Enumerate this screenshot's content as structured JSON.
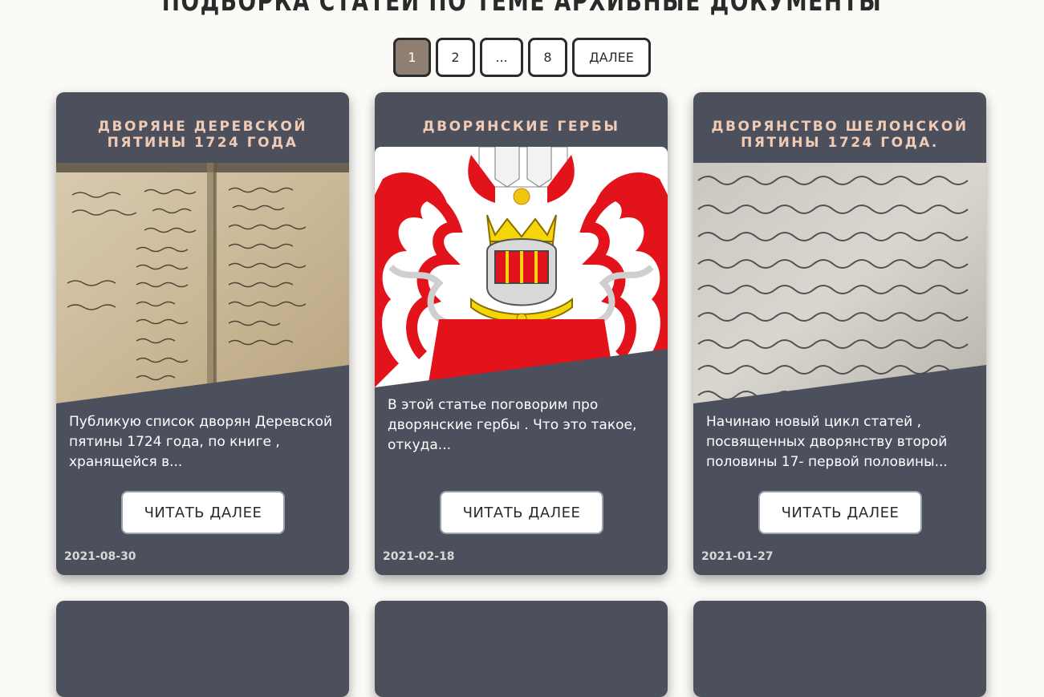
{
  "page": {
    "heading": "ПОДБОРКА СТАТЕЙ ПО ТЕМЕ АРХИВНЫЕ ДОКУМЕНТЫ"
  },
  "pagination": {
    "pages": [
      "1",
      "2",
      "...",
      "8"
    ],
    "current": "1",
    "next_label": "ДАЛЕЕ"
  },
  "articles": [
    {
      "title": "ДВОРЯНЕ ДЕРЕВСКОЙ ПЯТИНЫ 1724 ГОДА",
      "image_icon": "manuscript-photo",
      "description": "Публикую список дворян Деревской пятины 1724 года, по книге , хранящейся в...",
      "button_label": "ЧИТАТЬ ДАЛЕЕ",
      "date": "2021-08-30"
    },
    {
      "title": "ДВОРЯНСКИЕ ГЕРБЫ",
      "image_icon": "coat-of-arms-image",
      "description": "В этой статье поговорим про дворянские гербы . Что это такое, откуда...",
      "button_label": "ЧИТАТЬ ДАЛЕЕ",
      "date": "2021-02-18"
    },
    {
      "title": "ДВОРЯНСТВО ШЕЛОНСКОЙ ПЯТИНЫ 1724 ГОДА.",
      "image_icon": "handwritten-document-photo",
      "description": "Начинаю новый цикл статей , посвященных дворянству второй половины 17- первой половины...",
      "button_label": "ЧИТАТЬ ДАЛЕЕ",
      "date": "2021-01-27"
    }
  ],
  "colors": {
    "background": "#fbfaf7",
    "card": "#4b505c",
    "title_accent": "#f1cbb3",
    "active_page": "#8f7f72"
  }
}
